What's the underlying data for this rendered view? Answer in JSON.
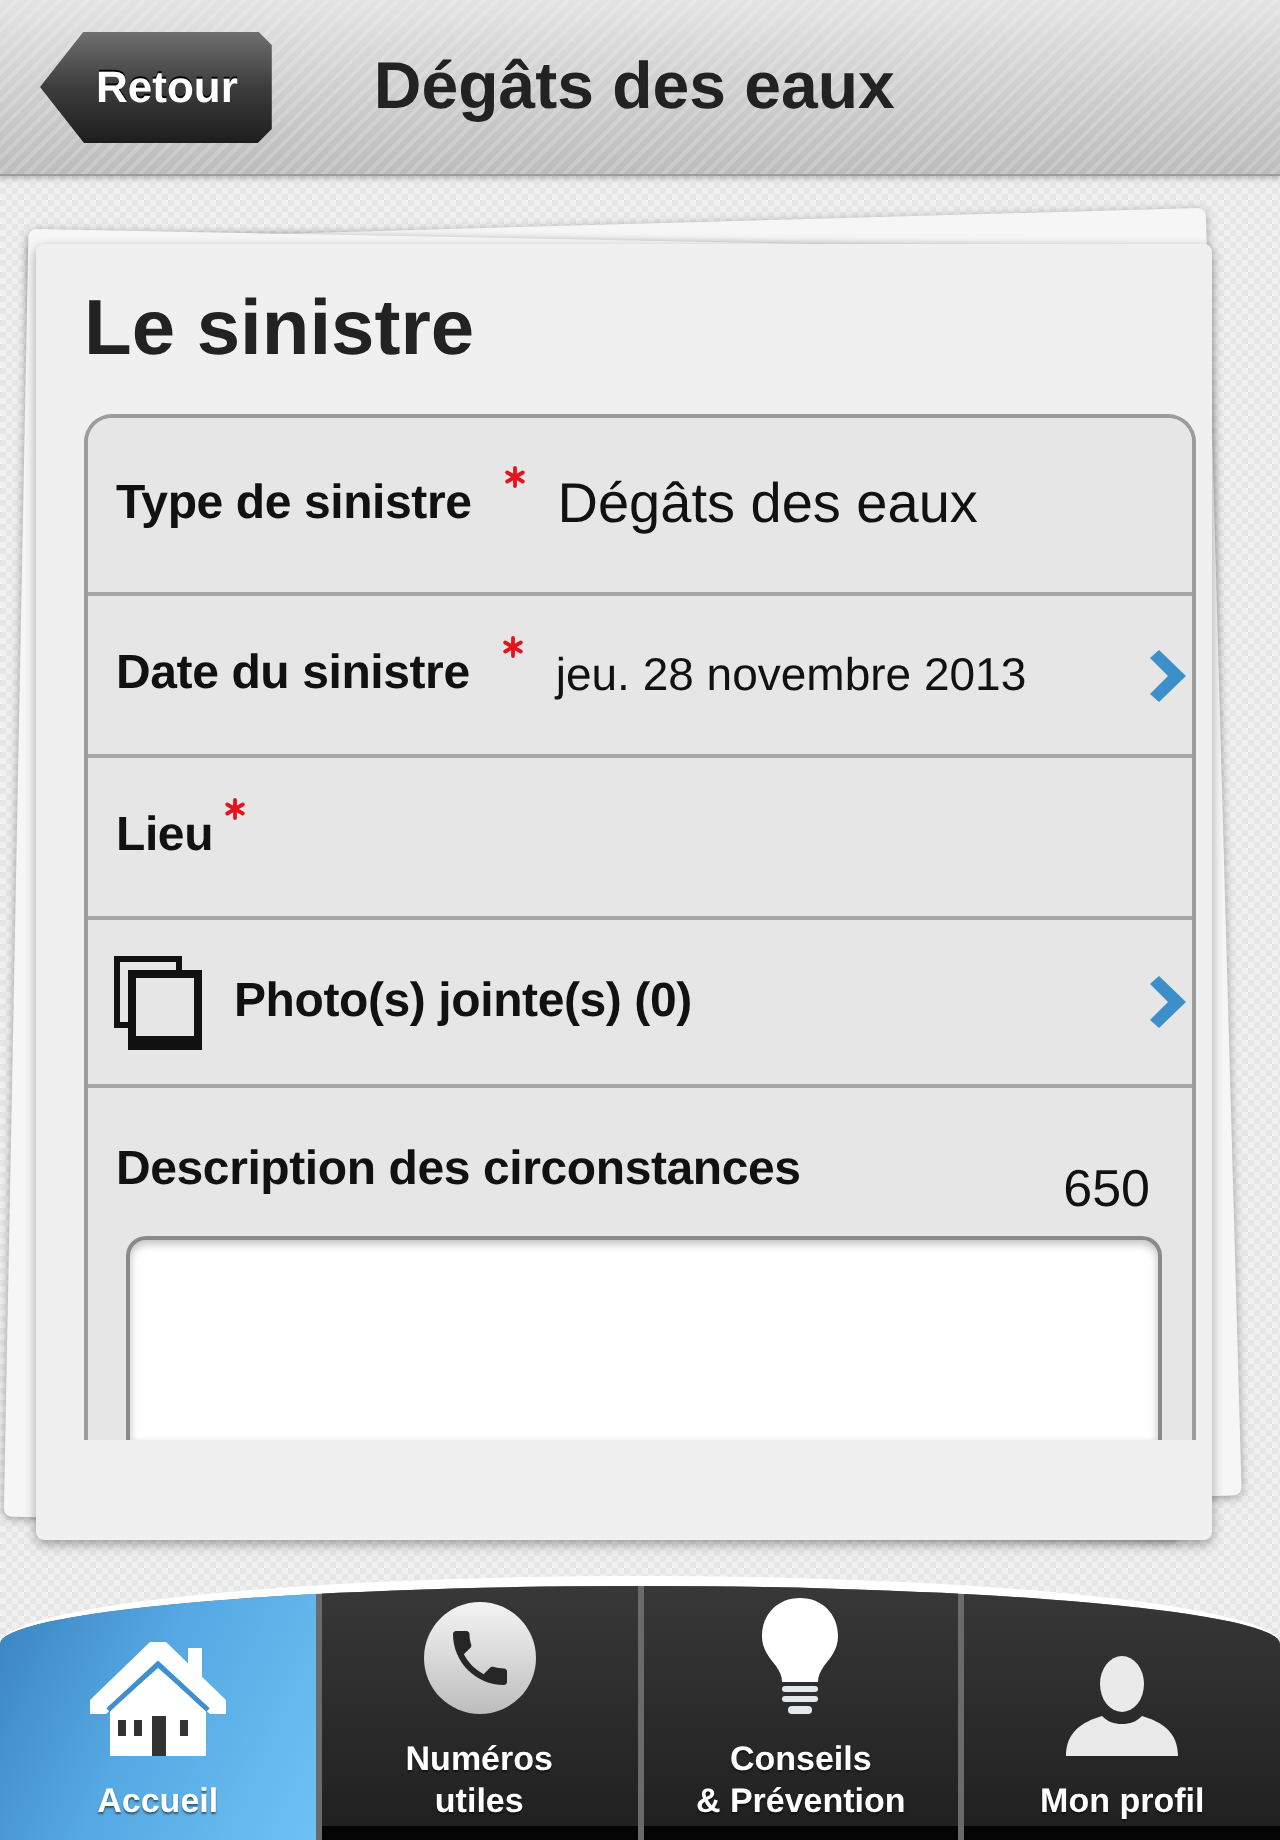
{
  "header": {
    "back_button": "Retour",
    "title": "Dégâts des eaux"
  },
  "section": {
    "title": "Le sinistre",
    "fields": [
      {
        "kind": "select",
        "label": "Type de sinistre",
        "required": true,
        "value": "Dégâts des eaux",
        "disclosure": false
      },
      {
        "kind": "date",
        "label": "Date du sinistre",
        "required": true,
        "value": "jeu. 28 novembre 2013",
        "disclosure": true
      },
      {
        "kind": "text",
        "label": "Lieu",
        "required": true,
        "disclosure": false
      },
      {
        "kind": "photos",
        "label": "Photo(s) jointe(s) (0)",
        "required": false,
        "disclosure": true
      },
      {
        "kind": "textarea",
        "label": "Description des circonstances",
        "required": false,
        "disclosure": false,
        "counter": "650"
      }
    ]
  },
  "tabs": [
    {
      "kind": "home",
      "label": "Accueil",
      "selected": true
    },
    {
      "kind": "phone",
      "label": "Numéros\nutiles",
      "selected": false
    },
    {
      "kind": "bulb",
      "label": "Conseils\n& Prévention",
      "selected": false
    },
    {
      "kind": "person",
      "label": "Mon profil",
      "selected": false
    }
  ]
}
